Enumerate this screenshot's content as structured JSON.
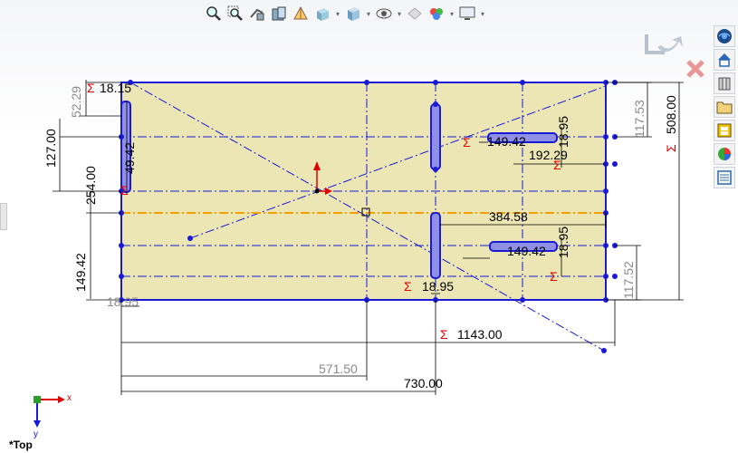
{
  "toolbar": {
    "items": [
      {
        "icon": "zoom-to-fit-icon"
      },
      {
        "icon": "zoom-to-area-icon"
      },
      {
        "icon": "previous-view-icon"
      },
      {
        "icon": "section-view-icon"
      },
      {
        "icon": "dynamic-annotation-icon"
      },
      {
        "icon": "view-orientation-icon"
      },
      {
        "icon": "display-style-icon"
      },
      {
        "icon": "hide-show-items-icon"
      },
      {
        "icon": "edit-appearance-icon"
      },
      {
        "icon": "apply-scene-icon"
      },
      {
        "icon": "view-settings-icon"
      }
    ]
  },
  "task_pane": {
    "items": [
      {
        "icon": "resources-icon"
      },
      {
        "icon": "design-library-icon"
      },
      {
        "icon": "3d-content-icon"
      },
      {
        "icon": "file-explorer-icon"
      },
      {
        "icon": "view-palette-icon"
      },
      {
        "icon": "appearances-icon"
      },
      {
        "icon": "custom-properties-icon"
      }
    ]
  },
  "confirmation_corner": {
    "accept_icon": "exit-sketch-icon",
    "cancel_icon": "cancel-icon"
  },
  "sketch": {
    "fill_color": "#ebe6b4",
    "line_color": "#1a1ad6",
    "highlight_color": "#f5a000",
    "dimension_color": "#000000",
    "driven_dimension_color": "#8a8a8a",
    "sigma_color": "#e00000",
    "sigma_symbol": "Σ",
    "dimensions": {
      "d_52_29": "52.29",
      "d_18_15": "18.15",
      "d_127": "127.00",
      "d_49_42_left": "49.42",
      "d_254": "254.00",
      "d_149_42_left": "149.42",
      "d_18_95_bottom_left": "18.95",
      "d_117_53": "117.53",
      "d_508": "508.00",
      "d_149_42_top_slot": "149.42",
      "d_18_95_top_slot": "18.95",
      "d_192_29": "192.29",
      "d_384_58": "384.58",
      "d_149_42_bottom_slot": "149.42",
      "d_18_95_bottom_slot": "18.95",
      "d_117_52": "117.52",
      "d_18_95_center": "18.95",
      "d_1143": "1143.00",
      "d_571_50": "571.50",
      "d_730": "730.00"
    }
  },
  "triad": {
    "x_label": "x",
    "y_label": "y"
  },
  "view_label": "*Top"
}
